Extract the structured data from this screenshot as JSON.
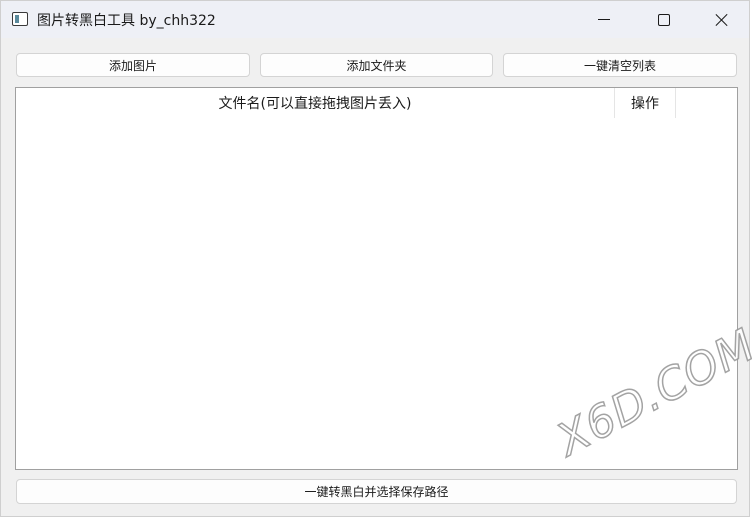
{
  "window": {
    "title": "图片转黑白工具 by_chh322",
    "app_icon": "app-window-icon",
    "controls": {
      "minimize_icon": "minimize-icon",
      "maximize_icon": "maximize-icon",
      "close_icon": "close-icon"
    }
  },
  "toolbar": {
    "add_image_label": "添加图片",
    "add_folder_label": "添加文件夹",
    "clear_list_label": "一键清空列表"
  },
  "table": {
    "columns": [
      "文件名(可以直接拖拽图片丢入)",
      "操作"
    ],
    "rows": []
  },
  "footer": {
    "convert_label": "一键转黑白并选择保存路径"
  },
  "watermark": {
    "text": "X6D.COM"
  }
}
